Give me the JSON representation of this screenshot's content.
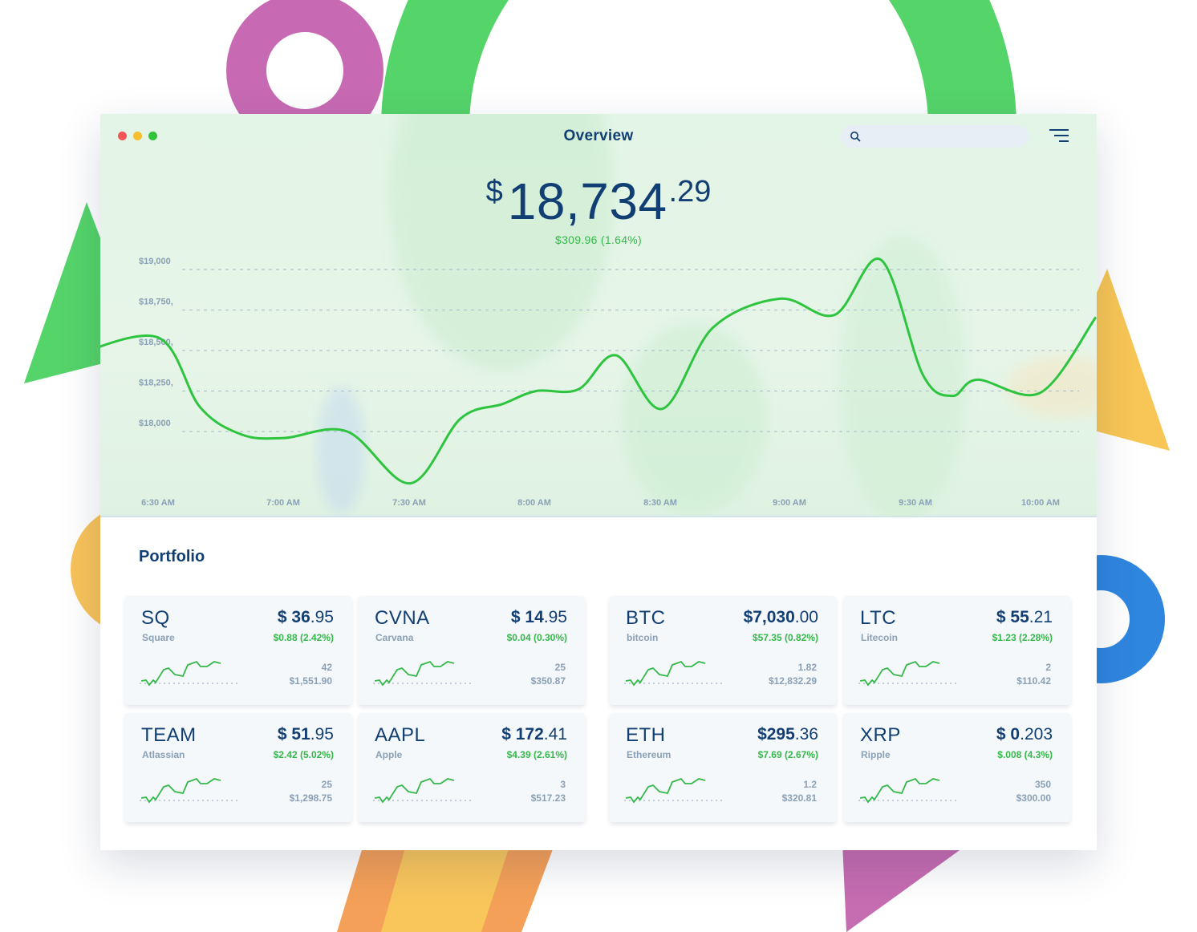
{
  "window": {
    "title": "Overview",
    "search": {
      "placeholder": "",
      "value": ""
    }
  },
  "summary": {
    "currency_symbol": "$",
    "balance_int": "18,734",
    "balance_dec": ".29",
    "change": "$309.96 (1.64%)"
  },
  "colors": {
    "navy": "#123f73",
    "green": "#35b84a",
    "line": "#2ec43f",
    "muted": "#8aa0b6"
  },
  "chart_data": {
    "type": "line",
    "title": "",
    "xlabel": "",
    "ylabel": "",
    "y_ticks": [
      "$19,000",
      "$18,750,",
      "$18,500,",
      "$18,250,",
      "$18,000"
    ],
    "y_tick_values": [
      19000,
      18750,
      18500,
      18250,
      18000
    ],
    "x_ticks": [
      "6:30 AM",
      "7:00 AM",
      "7:30 AM",
      "8:00 AM",
      "8:30 AM",
      "9:00 AM",
      "9:30 AM",
      "10:00 AM"
    ],
    "ylim": [
      17750,
      19050
    ],
    "grid": true,
    "series": [
      {
        "x": [
          "6:10 AM",
          "6:30 AM",
          "6:40 AM",
          "6:50 AM",
          "7:00 AM",
          "7:15 AM",
          "7:30 AM",
          "7:42 AM",
          "7:52 AM",
          "8:00 AM",
          "8:10 AM",
          "8:19 AM",
          "8:30 AM",
          "8:42 AM",
          "8:58 AM",
          "9:11 AM",
          "9:22 AM",
          "9:32 AM",
          "9:39 AM",
          "9:45 AM",
          "10:00 AM",
          "10:13 AM"
        ],
        "y": [
          18470,
          18580,
          18150,
          17980,
          17960,
          18000,
          17680,
          18080,
          18170,
          18250,
          18260,
          18470,
          18140,
          18640,
          18820,
          18720,
          19060,
          18350,
          18220,
          18320,
          18240,
          18700
        ]
      }
    ]
  },
  "portfolio": {
    "title": "Portfolio",
    "holdings": [
      {
        "symbol": "SQ",
        "name": "Square",
        "price_int": "$ 36",
        "price_dec": ".95",
        "change": "$0.88 (2.42%)",
        "qty": "42",
        "value": "$1,551.90"
      },
      {
        "symbol": "CVNA",
        "name": "Carvana",
        "price_int": "$ 14",
        "price_dec": ".95",
        "change": "$0.04 (0.30%)",
        "qty": "25",
        "value": "$350.87"
      },
      {
        "symbol": "BTC",
        "name": "bitcoin",
        "price_int": "$7,030",
        "price_dec": ".00",
        "change": "$57.35 (0.82%)",
        "qty": "1.82",
        "value": "$12,832.29"
      },
      {
        "symbol": "LTC",
        "name": "Litecoin",
        "price_int": "$ 55",
        "price_dec": ".21",
        "change": "$1.23 (2.28%)",
        "qty": "2",
        "value": "$110.42"
      },
      {
        "symbol": "TEAM",
        "name": "Atlassian",
        "price_int": "$ 51",
        "price_dec": ".95",
        "change": "$2.42 (5.02%)",
        "qty": "25",
        "value": "$1,298.75"
      },
      {
        "symbol": "AAPL",
        "name": "Apple",
        "price_int": "$ 172",
        "price_dec": ".41",
        "change": "$4.39 (2.61%)",
        "qty": "3",
        "value": "$517.23"
      },
      {
        "symbol": "ETH",
        "name": "Ethereum",
        "price_int": "$295",
        "price_dec": ".36",
        "change": "$7.69 (2.67%)",
        "qty": "1.2",
        "value": "$320.81"
      },
      {
        "symbol": "XRP",
        "name": "Ripple",
        "price_int": "$ 0",
        "price_dec": ".203",
        "change": "$.008 (4.3%)",
        "qty": "350",
        "value": "$300.00"
      }
    ]
  }
}
